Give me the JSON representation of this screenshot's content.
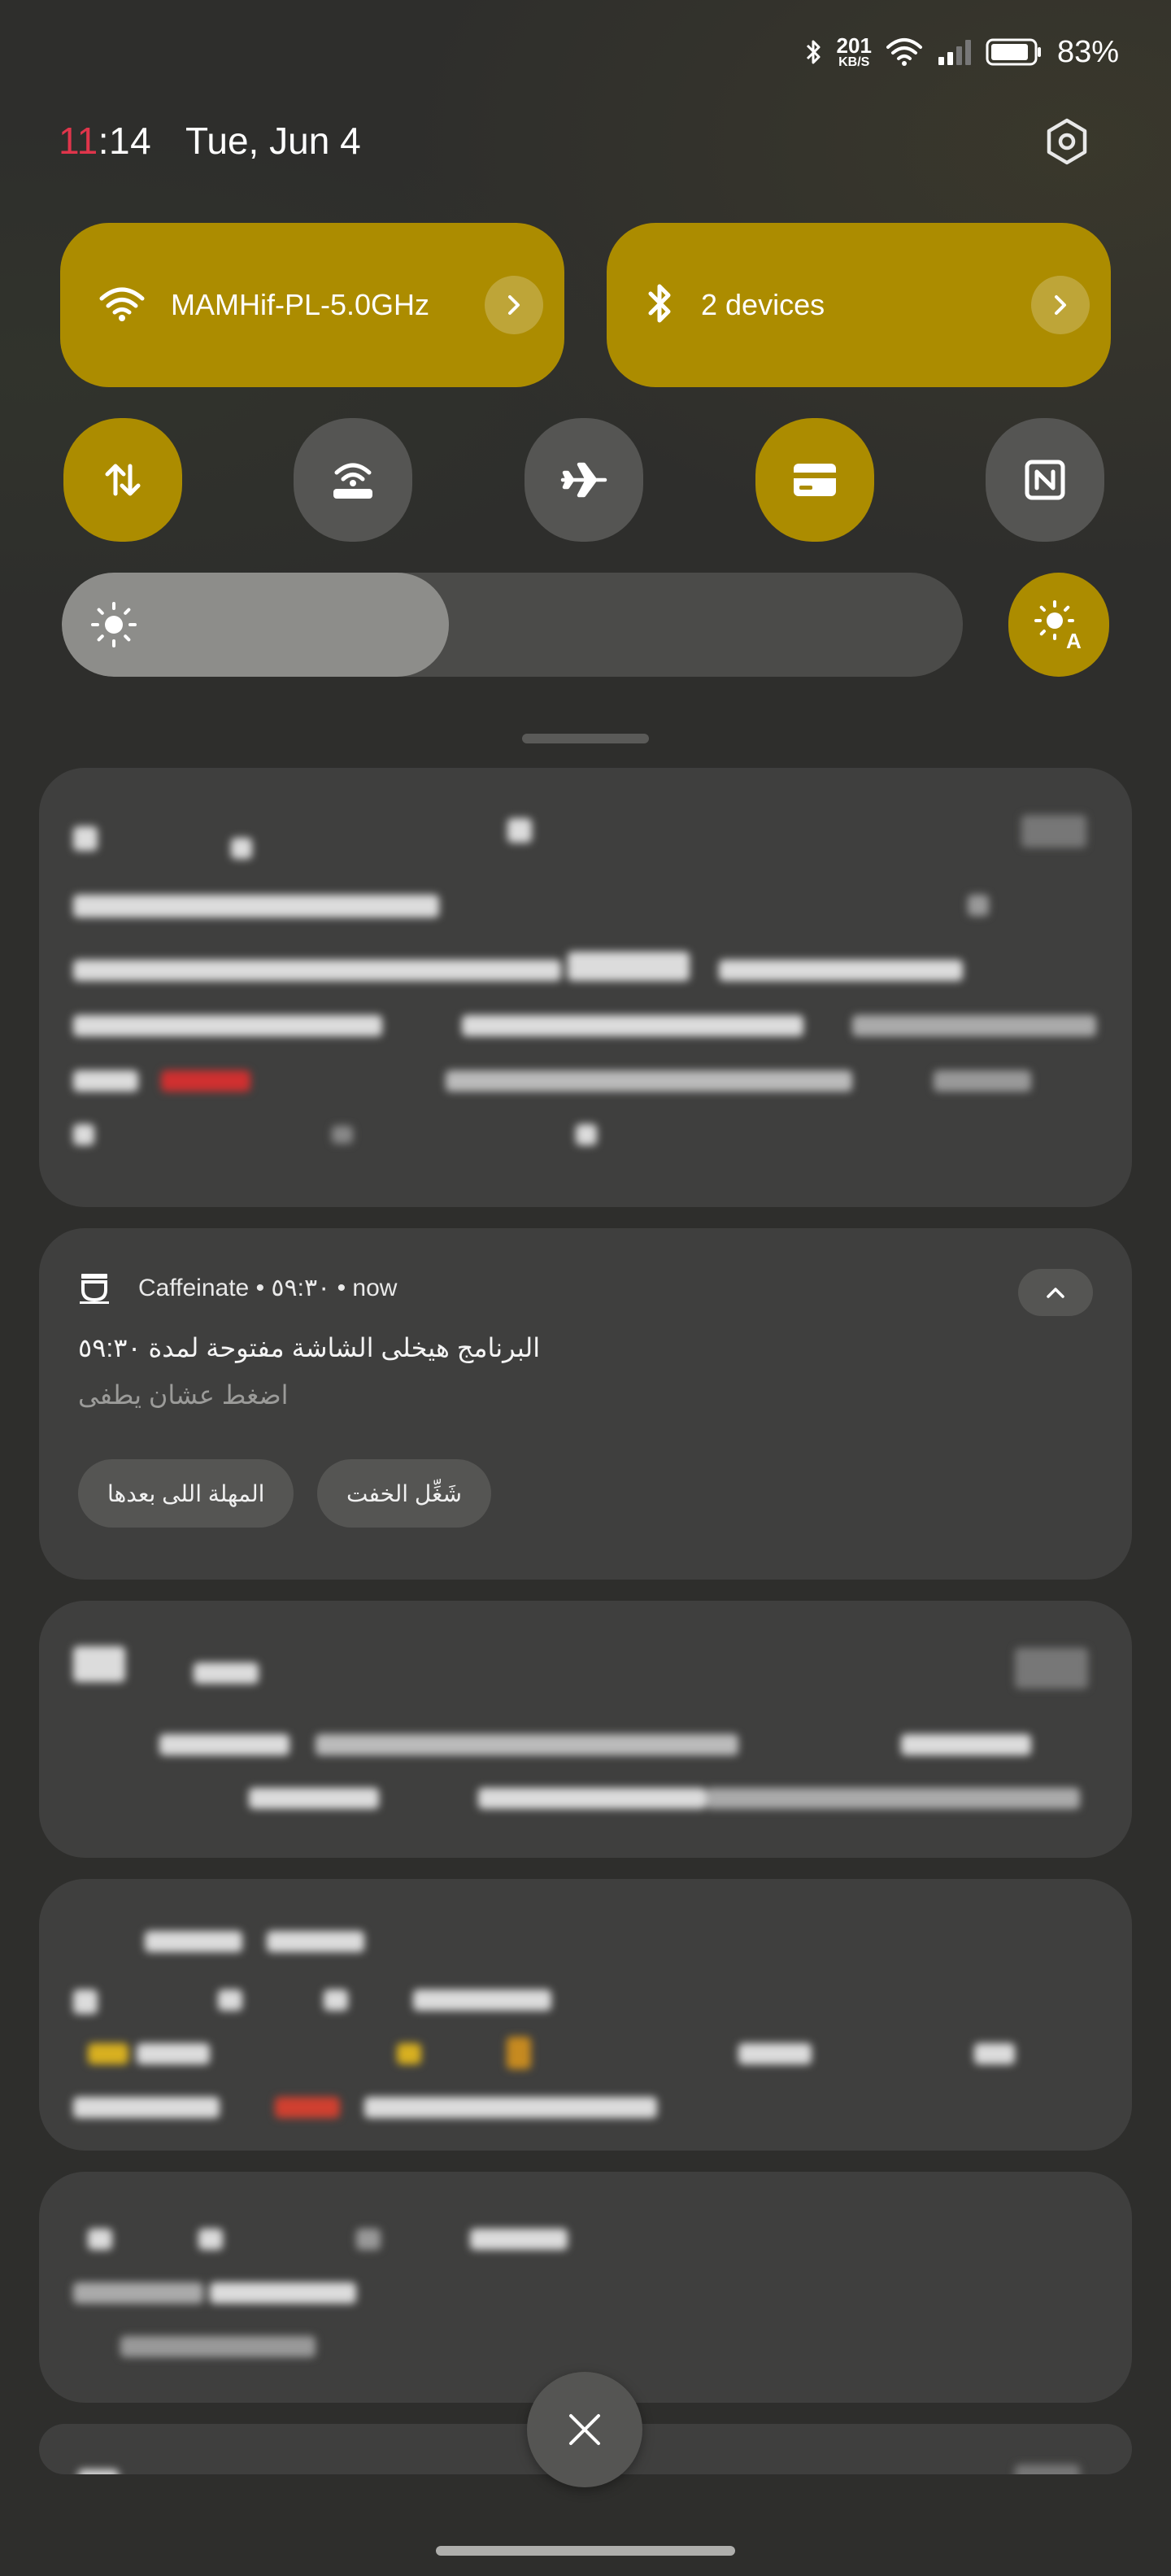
{
  "status_bar": {
    "speed_value": "201",
    "speed_unit": "KB/S",
    "battery_percent": "83%",
    "icons": [
      "bluetooth-icon",
      "wifi-icon",
      "signal-icon",
      "battery-icon"
    ]
  },
  "header": {
    "time_hour": "11",
    "time_rest": ":14",
    "date": "Tue, Jun 4"
  },
  "quick_tiles": {
    "wifi": {
      "label": "MAMHif-PL-5.0GHz",
      "icon": "wifi-icon",
      "active": true
    },
    "bluetooth": {
      "label": "2 devices",
      "icon": "bluetooth-icon",
      "active": true
    },
    "toggles": [
      {
        "name": "mobile-data",
        "icon": "data-transfer-icon",
        "active": true
      },
      {
        "name": "hotspot",
        "icon": "hotspot-icon",
        "active": false
      },
      {
        "name": "airplane-mode",
        "icon": "airplane-icon",
        "active": false
      },
      {
        "name": "wallet",
        "icon": "card-icon",
        "active": true
      },
      {
        "name": "nfc",
        "icon": "nfc-icon",
        "active": false
      }
    ]
  },
  "brightness": {
    "level": 0.43,
    "auto": true
  },
  "notification_caffeinate": {
    "app_name": "Caffeinate",
    "separator": "•",
    "timer": "٥٩:٣٠",
    "time": "now",
    "title": "البرنامج هيخلى الشاشة مفتوحة لمدة ٥٩:٣٠",
    "subtitle": "اضغط عشان يطفى",
    "action_next": "المهلة اللى بعدها",
    "action_light": "شَغِّل الخفت"
  },
  "colors": {
    "accent": "#ac8c00",
    "background": "#2e2e2c",
    "card": "#3f3f3e",
    "toggle_off": "#555553",
    "clock_hour": "#e0354b"
  }
}
